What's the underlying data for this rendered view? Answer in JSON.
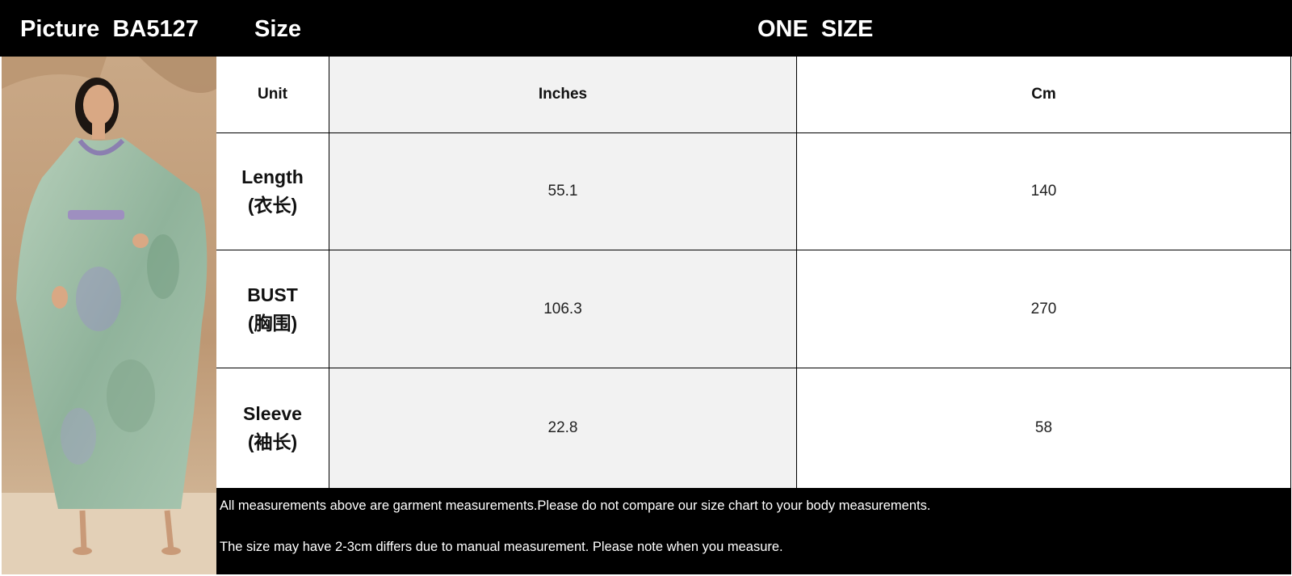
{
  "header": {
    "picture_label": "Picture",
    "code": "BA5127",
    "size_label": "Size",
    "size_value": "ONE  SIZE"
  },
  "table": {
    "unit_label": "Unit",
    "columns": [
      "Inches",
      "Cm"
    ],
    "rows": [
      {
        "label": "Length",
        "label_cn": "(衣长)",
        "inches": "55.1",
        "cm": "140"
      },
      {
        "label": "BUST",
        "label_cn": "(胸围)",
        "inches": "106.3",
        "cm": "270"
      },
      {
        "label": "Sleeve",
        "label_cn": "(袖长)",
        "inches": "22.8",
        "cm": "58"
      }
    ]
  },
  "footer": {
    "line1": "All measurements above are garment measurements.Please do not compare our size chart to your body measurements.",
    "line2": "The size may have 2-3cm differs due to manual measurement. Please note when you measure."
  },
  "colors": {
    "header_bg": "#000000",
    "grey_cell": "#f2f2f2",
    "dress": "#9fbfa8",
    "background_stone": "#c8a887"
  },
  "photo": {
    "subject": "model wearing green floral satin kaftan with embellished neckline and belt"
  }
}
